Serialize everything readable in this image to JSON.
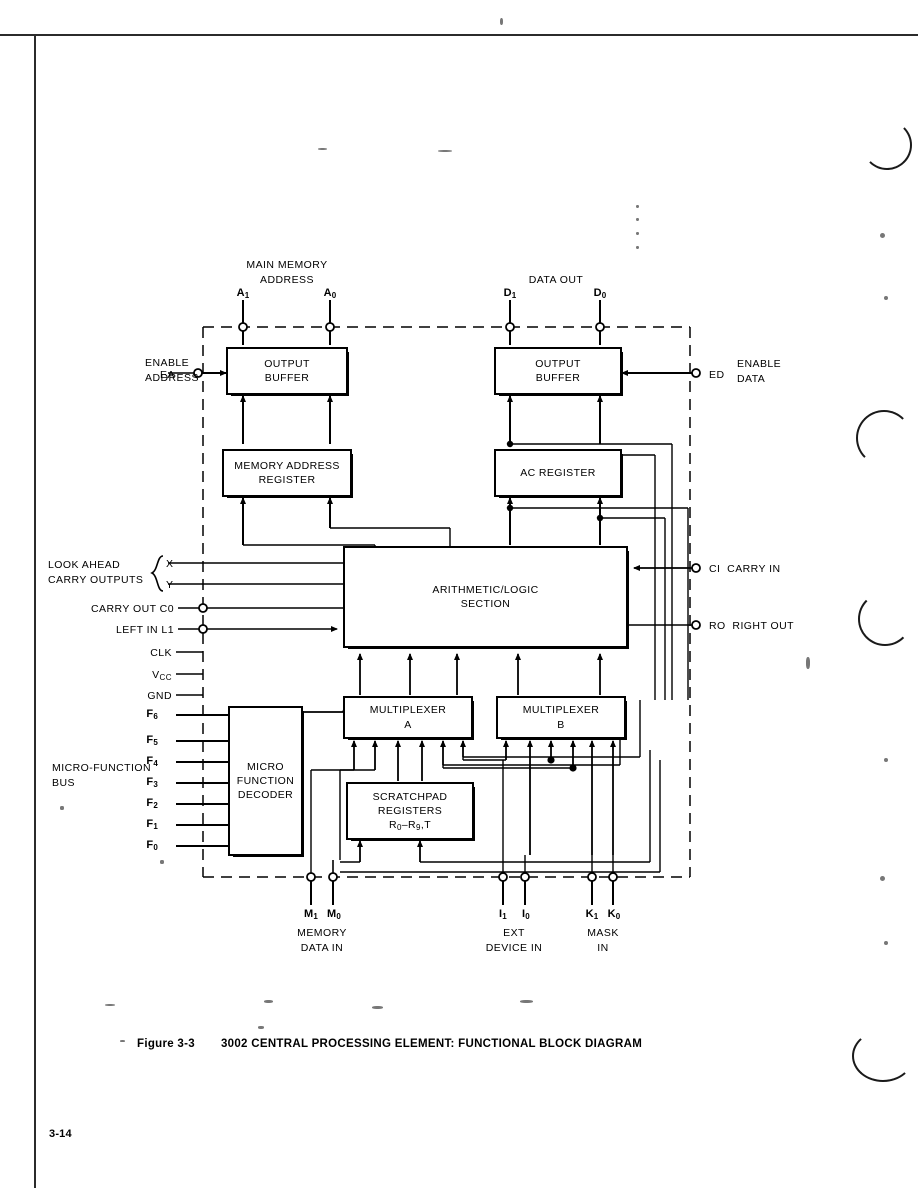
{
  "page": {
    "number": "3-14",
    "caption_prefix": "Figure 3-3",
    "caption_title": "3002 CENTRAL PROCESSING ELEMENT:  FUNCTIONAL BLOCK DIAGRAM"
  },
  "diagram": {
    "title": "3002 Central Processing Element Functional Block Diagram",
    "top_buses": [
      {
        "name": "main-memory-address",
        "label_line1": "MAIN MEMORY",
        "label_line2": "ADDRESS",
        "pins": [
          "A1",
          "A0"
        ]
      },
      {
        "name": "data-out",
        "label_line1": "DATA OUT",
        "label_line2": "",
        "pins": [
          "D1",
          "D0"
        ]
      }
    ],
    "blocks": [
      {
        "id": "output-buffer-address",
        "lines": [
          "OUTPUT",
          "BUFFER"
        ]
      },
      {
        "id": "memory-address-register",
        "lines": [
          "MEMORY ADDRESS",
          "REGISTER"
        ]
      },
      {
        "id": "output-buffer-data",
        "lines": [
          "OUTPUT",
          "BUFFER"
        ]
      },
      {
        "id": "ac-register",
        "lines": [
          "AC REGISTER"
        ]
      },
      {
        "id": "arithmetic-logic-section",
        "lines": [
          "ARITHMETIC/LOGIC",
          "SECTION"
        ]
      },
      {
        "id": "multiplexer-a",
        "lines": [
          "MULTIPLEXER",
          "A"
        ]
      },
      {
        "id": "multiplexer-b",
        "lines": [
          "MULTIPLEXER",
          "B"
        ]
      },
      {
        "id": "scratchpad-registers",
        "lines": [
          "SCRATCHPAD",
          "REGISTERS",
          "R0-R9,T"
        ]
      },
      {
        "id": "micro-function-decoder",
        "lines": [
          "MICRO",
          "FUNCTION",
          "DECODER"
        ]
      }
    ],
    "left_pins": [
      {
        "name": "enable-address",
        "desc_line1": "ENABLE",
        "desc_line2": "ADDRESS",
        "symbol": "EA"
      },
      {
        "name": "look-ahead-x",
        "desc_line1": "LOOK AHEAD",
        "desc_line2": "CARRY OUTPUTS",
        "symbol": "X"
      },
      {
        "name": "look-ahead-y",
        "symbol": "Y"
      },
      {
        "name": "carry-out",
        "symbol": "CARRY OUT C0"
      },
      {
        "name": "left-in",
        "symbol": "LEFT IN L1"
      },
      {
        "name": "clock",
        "symbol": "CLK"
      },
      {
        "name": "vcc",
        "symbol": "VCC"
      },
      {
        "name": "gnd",
        "symbol": "GND"
      }
    ],
    "micro_function_bus": {
      "label_line1": "MICRO-FUNCTION",
      "label_line2": "BUS",
      "pins": [
        "F6",
        "F5",
        "F4",
        "F3",
        "F2",
        "F1",
        "F0"
      ]
    },
    "right_pins": [
      {
        "name": "enable-data",
        "symbol": "ED",
        "desc_line1": "ENABLE",
        "desc_line2": "DATA"
      },
      {
        "name": "carry-in",
        "symbol": "CI",
        "desc_line1": "CARRY IN",
        "desc_line2": ""
      },
      {
        "name": "right-out",
        "symbol": "RO",
        "desc_line1": "RIGHT OUT",
        "desc_line2": ""
      }
    ],
    "bottom_buses": [
      {
        "name": "memory-data-in",
        "pins": [
          "M1",
          "M0"
        ],
        "label_line1": "MEMORY",
        "label_line2": "DATA IN"
      },
      {
        "name": "ext-device-in",
        "pins": [
          "I1",
          "I0"
        ],
        "label_line1": "EXT",
        "label_line2": "DEVICE IN"
      },
      {
        "name": "mask-in",
        "pins": [
          "K1",
          "K0"
        ],
        "label_line1": "MASK",
        "label_line2": "IN"
      }
    ]
  },
  "colors": {
    "ink": "#000000",
    "paper": "#ffffff"
  }
}
